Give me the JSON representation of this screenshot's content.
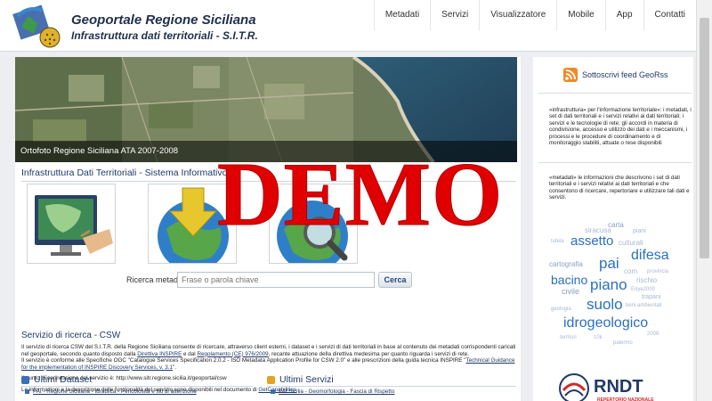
{
  "header": {
    "title": "Geoportale Regione Siciliana",
    "subtitle": "Infrastruttura dati territoriali - S.I.T.R.",
    "nav": [
      "Metadati",
      "Servizi",
      "Visualizzatore",
      "Mobile",
      "App",
      "Contatti"
    ]
  },
  "banner": {
    "caption": "Ortofoto Regione Siciliana ATA 2007-2008"
  },
  "main": {
    "section_title": "Infrastruttura Dati Territoriali - Sistema Informativo T",
    "section_title_tail": "gione",
    "search": {
      "label": "Ricerca metadati:",
      "placeholder": "Frase o parola chiave",
      "button": "Cerca"
    },
    "csw": {
      "title": "Servizio di ricerca - CSW",
      "p1_a": "Il servizio di ricerca CSW del S.I.T.R. della Regione Siciliana consente di ricercare, attraverso client esterni, i dataset e i servizi di dati territoriali in base al contenuto dei metadati corrispondenti caricati nel geoportale, secondo quanto disposto dalla ",
      "p1_link1": "Direttiva INSPIRE",
      "p1_b": " e dal ",
      "p1_link2": "Regolamento (CE) 976/2009",
      "p1_c": ", recante attuazione della direttiva medesima per quanto riguarda i servizi di rete.",
      "p2_a": "Il servizio è conforme alle Specifiche OGC \"Catalogue Services Specification 2.0.2 - ISO Metadata Application Profile for CSW 2.0\" e alle prescrizioni della guida tecnica INSPIRE \"",
      "p2_link": "Technical Guidance for the implementation of INSPIRE Discovery Services, v. 3.1",
      "p2_b": "\".",
      "endpoint": "Il punto di connessione del servizio è: http://www.sitr.regione.sicilia.it/geoportal/csw",
      "info_a": "Le informazioni e la descrizione delle funzionalità del servizio sono disponibili nel documento di ",
      "info_link": "GetCapabilities"
    },
    "latest_datasets": {
      "title": "Ultimi Dataset",
      "first": "PAI - Regione Siciliana - Idraulica - Pericolosità e siti di attenzione"
    },
    "latest_services": {
      "title": "Ultimi Servizi",
      "first": "PAI Sicilia - Geomorfologia - Fascia di Rispetto"
    }
  },
  "sidebar": {
    "rss": "Sottoscrivi feed GeoRss",
    "box1": "«infrastruttura» per l'informazione territoriale»: i metadati, i set di dati territoriali e i servizi relativi ai dati territoriali; i servizi e le tecnologie di rete; gli accordi in materia di condivisione, accesso e utilizzo dei dati e i meccanismi, i processi e le procedure di coordinamento e di monitoraggio stabiliti, attuate o rese disponibili",
    "box2": "«metadati» le informazioni che descrivono i set di dati territoriali e i servizi relativi ai dati territoriali e che consentono di ricercare, repertoriare e utilizzare tali dati e servizi.",
    "tag_cloud": [
      {
        "text": "carta",
        "color": "#8aa0c6",
        "size": 8
      },
      {
        "text": "siracusa",
        "color": "#a8b8d4",
        "size": 8
      },
      {
        "text": "piani",
        "color": "#a8b8d4",
        "size": 7
      },
      {
        "text": "tutela",
        "color": "#a8b8d4",
        "size": 6
      },
      {
        "text": "assetto",
        "color": "#2a6fc2",
        "size": 15
      },
      {
        "text": "culturali",
        "color": "#a8b8d4",
        "size": 8
      },
      {
        "text": "difesa",
        "color": "#2a6fc2",
        "size": 16
      },
      {
        "text": "cartografia",
        "color": "#8aa0c6",
        "size": 8
      },
      {
        "text": "pai",
        "color": "#2a6fc2",
        "size": 17
      },
      {
        "text": "com",
        "color": "#a8b8d4",
        "size": 8
      },
      {
        "text": "provincia",
        "color": "#a8b8d4",
        "size": 6
      },
      {
        "text": "bacino",
        "color": "#2a6fc2",
        "size": 14
      },
      {
        "text": "rischio",
        "color": "#a8b8d4",
        "size": 8
      },
      {
        "text": "civile",
        "color": "#8aa0c6",
        "size": 9
      },
      {
        "text": "piano",
        "color": "#2a6fc2",
        "size": 17
      },
      {
        "text": "Eoye2000",
        "color": "#a8b8d4",
        "size": 6
      },
      {
        "text": "trapani",
        "color": "#a8b8d4",
        "size": 7
      },
      {
        "text": "suolo",
        "color": "#2a6fc2",
        "size": 17
      },
      {
        "text": "beni ambientali",
        "color": "#a8b8d4",
        "size": 6
      },
      {
        "text": "geologia",
        "color": "#a8b8d4",
        "size": 6
      },
      {
        "text": "idrogeologico",
        "color": "#2a6fc2",
        "size": 16
      },
      {
        "text": "territori",
        "color": "#a8b8d4",
        "size": 6
      },
      {
        "text": "10k",
        "color": "#a8b8d4",
        "size": 6
      },
      {
        "text": "2008",
        "color": "#a8b8d4",
        "size": 6
      },
      {
        "text": "palermo",
        "color": "#a8b8d4",
        "size": 6
      }
    ]
  },
  "watermark": "DEMO"
}
